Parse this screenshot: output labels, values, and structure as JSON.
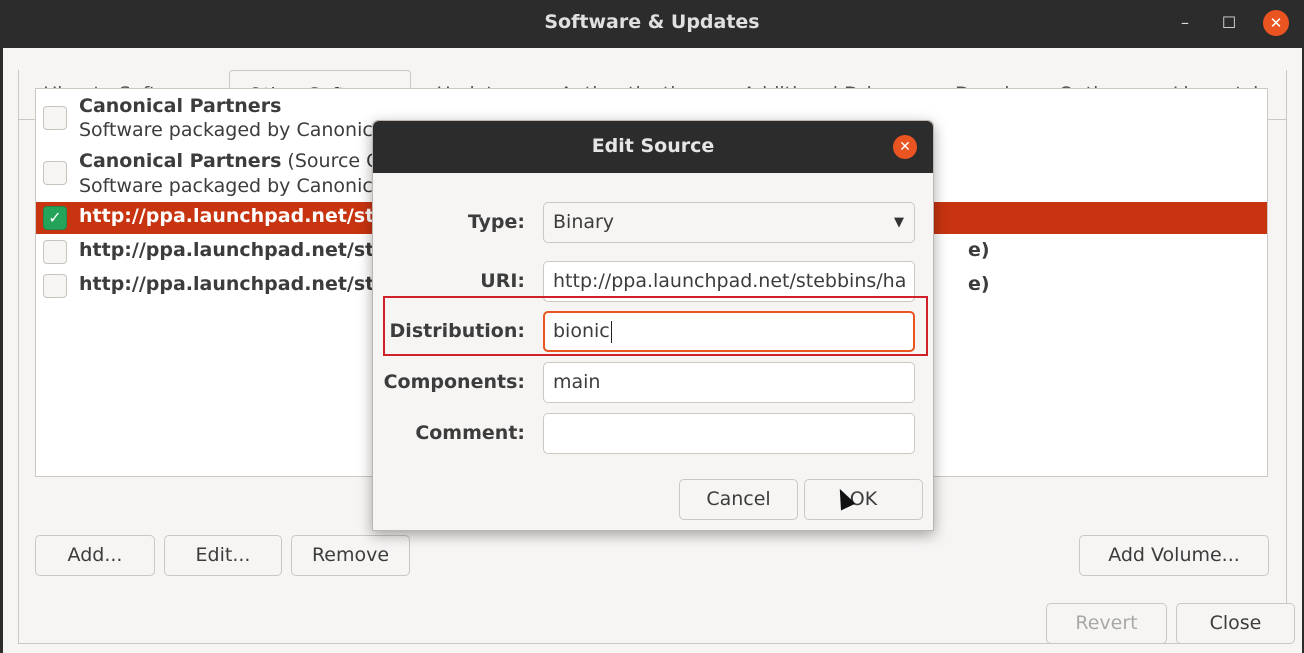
{
  "window": {
    "title": "Software & Updates",
    "controls": [
      "minimize-icon",
      "maximize-icon",
      "close-icon"
    ]
  },
  "tabs": [
    {
      "label": "Ubuntu Software"
    },
    {
      "label": "Other Software"
    },
    {
      "label": "Updates"
    },
    {
      "label": "Authentication"
    },
    {
      "label": "Additional Drivers"
    },
    {
      "label": "Developer Options"
    },
    {
      "label": "Livepatch"
    }
  ],
  "sources": [
    {
      "title": "Canonical Partners",
      "title_suffix": "",
      "subtitle": "Software packaged by Canonica",
      "checked": false,
      "selected": false
    },
    {
      "title": "Canonical Partners",
      "title_suffix": " (Source Co",
      "subtitle": "Software packaged by Canonica",
      "checked": false,
      "selected": false
    },
    {
      "title": "http://ppa.launchpad.net/ste",
      "title_suffix": "",
      "subtitle": "",
      "tail": "",
      "checked": true,
      "selected": true
    },
    {
      "title": "http://ppa.launchpad.net/ste",
      "title_suffix": "",
      "subtitle": "",
      "tail": "e)",
      "checked": false,
      "selected": false
    },
    {
      "title": "http://ppa.launchpad.net/ste",
      "title_suffix": "",
      "subtitle": "",
      "tail": "e)",
      "checked": false,
      "selected": false
    }
  ],
  "list_buttons": {
    "add": "Add...",
    "edit": "Edit...",
    "remove": "Remove",
    "add_volume": "Add Volume..."
  },
  "footer_buttons": {
    "revert": "Revert",
    "close": "Close"
  },
  "dialog": {
    "title": "Edit Source",
    "type_label": "Type:",
    "type_value": "Binary",
    "uri_label": "URI:",
    "uri_value": "http://ppa.launchpad.net/stebbins/ha",
    "distribution_label": "Distribution:",
    "distribution_value": "bionic",
    "components_label": "Components:",
    "components_value": "main",
    "comment_label": "Comment:",
    "comment_value": "",
    "cancel": "Cancel",
    "ok": "OK"
  },
  "colors": {
    "accent": "#e95420",
    "selection": "#c7340f",
    "check": "#23a45a",
    "annotation": "#d0202a"
  }
}
